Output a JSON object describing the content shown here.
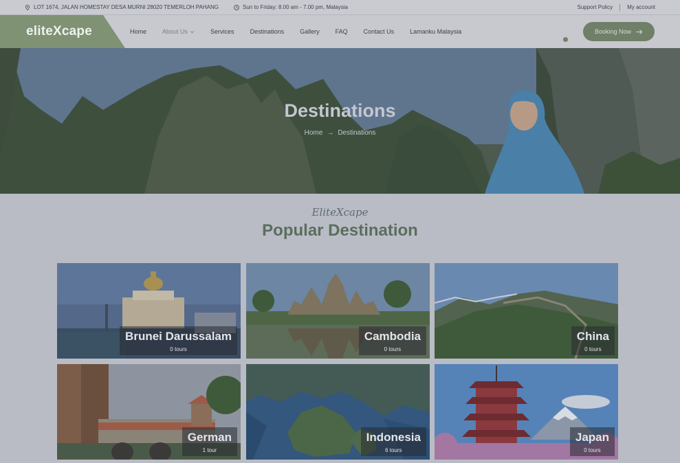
{
  "topbar": {
    "address": "LOT 1674, JALAN HOMESTAY DESA MURNI 28020 TEMERLOH PAHANG",
    "hours": "Sun to Friday: 8.00 am - 7.00 pm, Malaysia",
    "support": "Support Policy",
    "account": "My account"
  },
  "nav": {
    "logo": "eliteXcape",
    "links": [
      "Home",
      "About Us",
      "Services",
      "Destinations",
      "Gallery",
      "FAQ",
      "Contact Us",
      "Lamanku Malaysia"
    ],
    "booking": "Booking Now"
  },
  "hero": {
    "title": "Destinations",
    "crumb_home": "Home",
    "crumb_sep": "→",
    "crumb_current": "Destinations"
  },
  "section": {
    "script": "EliteXcape",
    "title": "Popular Destination"
  },
  "destinations": [
    {
      "name": "Brunei Darussalam",
      "tours": "0 tours"
    },
    {
      "name": "Cambodia",
      "tours": "0 tours"
    },
    {
      "name": "China",
      "tours": "0 tours"
    },
    {
      "name": "German",
      "tours": "1 tour"
    },
    {
      "name": "Indonesia",
      "tours": "6 tours"
    },
    {
      "name": "Japan",
      "tours": "0 tours"
    }
  ]
}
